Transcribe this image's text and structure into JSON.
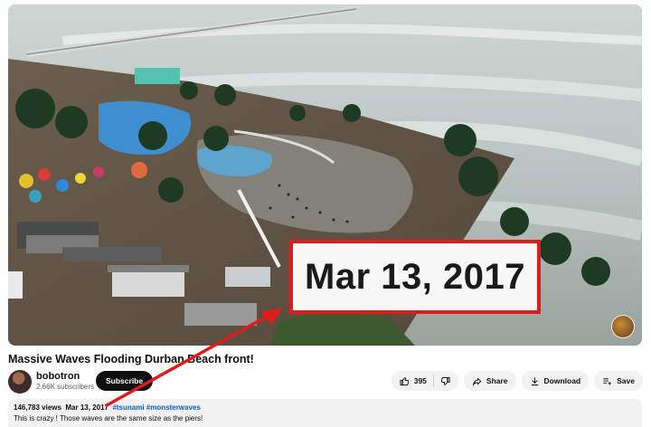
{
  "video": {
    "overlay_date": "Mar 13, 2017",
    "title": "Massive Waves Flooding Durban Beach front!"
  },
  "channel": {
    "name": "bobotron",
    "subscribers": "2.66K subscribers",
    "subscribe_label": "Subscribe"
  },
  "actions": {
    "like_count": "395",
    "share_label": "Share",
    "download_label": "Download",
    "save_label": "Save"
  },
  "description": {
    "views": "146,783 views",
    "date": "Mar 13, 2017",
    "hashtags": [
      "#tsunami",
      "#monsterwaves"
    ],
    "text": "This is crazy ! Those waves are the same size as the piers!"
  },
  "colors": {
    "annotation_red": "#e01b1b",
    "hashtag_blue": "#065fd4"
  }
}
